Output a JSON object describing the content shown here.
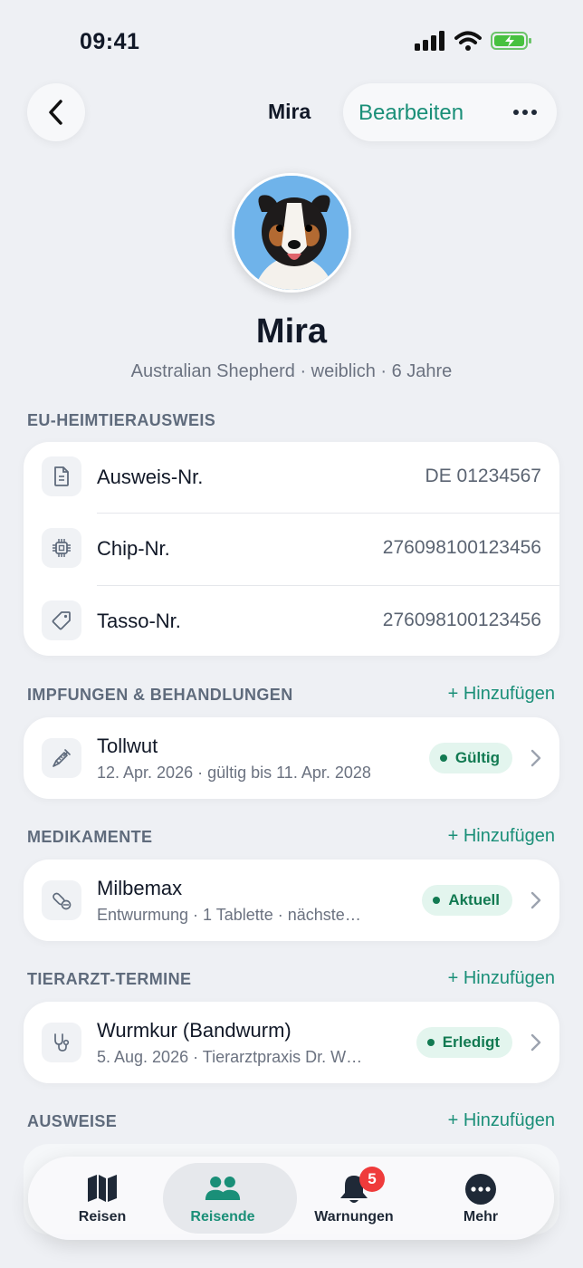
{
  "status": {
    "time": "09:41"
  },
  "nav": {
    "title": "Mira",
    "edit_label": "Bearbeiten"
  },
  "profile": {
    "name": "Mira",
    "subtitle": "Australian Shepherd · weiblich · 6 Jahre"
  },
  "passport": {
    "section_title": "EU-HEIMTIERAUSWEIS",
    "rows": [
      {
        "label": "Ausweis-Nr.",
        "value": "DE 01234567",
        "icon": "document-icon"
      },
      {
        "label": "Chip-Nr.",
        "value": "276098100123456",
        "icon": "chip-icon"
      },
      {
        "label": "Tasso-Nr.",
        "value": "276098100123456",
        "icon": "tag-icon"
      }
    ]
  },
  "vaccinations": {
    "section_title": "IMPFUNGEN & BEHANDLUNGEN",
    "add_label": "+ Hinzufügen",
    "item": {
      "title": "Tollwut",
      "subtitle": "12. Apr. 2026 · gültig bis 11. Apr. 2028",
      "badge": "Gültig",
      "icon": "syringe-icon"
    }
  },
  "medications": {
    "section_title": "MEDIKAMENTE",
    "add_label": "+ Hinzufügen",
    "item": {
      "title": "Milbemax",
      "subtitle": "Entwurmung · 1 Tablette · nächste…",
      "badge": "Aktuell",
      "icon": "pill-icon"
    }
  },
  "vet_appointments": {
    "section_title": "TIERARZT-TERMINE",
    "add_label": "+ Hinzufügen",
    "item": {
      "title": "Wurmkur (Bandwurm)",
      "subtitle": "5. Aug. 2026 · Tierarztpraxis Dr. W…",
      "badge": "Erledigt",
      "icon": "stethoscope-icon"
    }
  },
  "documents": {
    "section_title": "AUSWEISE",
    "add_label": "+ Hinzufügen"
  },
  "tabbar": {
    "tabs": [
      {
        "label": "Reisen",
        "icon": "map-icon"
      },
      {
        "label": "Reisende",
        "icon": "people-icon",
        "active": true
      },
      {
        "label": "Warnungen",
        "icon": "bell-icon",
        "badge": "5"
      },
      {
        "label": "Mehr",
        "icon": "more-icon"
      }
    ]
  },
  "colors": {
    "accent": "#1a8f78",
    "badge_bg": "#e3f5ee",
    "alert": "#ef3b3b",
    "background": "#eef0f4"
  }
}
